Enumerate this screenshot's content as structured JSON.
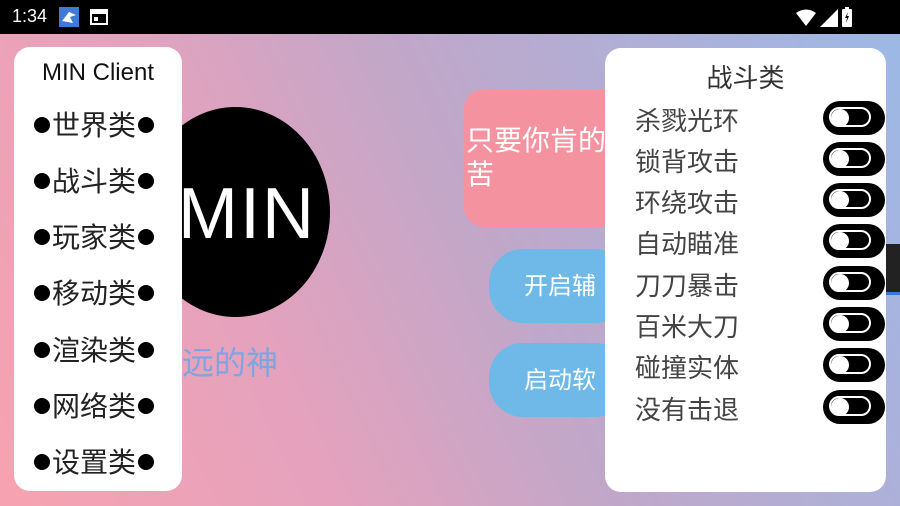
{
  "status_bar": {
    "time": "1:34",
    "icons": [
      "bird-app-icon",
      "window-app-icon",
      "wifi-icon",
      "signal-icon",
      "battery-icon"
    ]
  },
  "main": {
    "logo_text": "MIN",
    "subtitle": "远的神",
    "message": "只要你肯的苦",
    "button_1": "开启辅",
    "button_2": "启动软"
  },
  "sidebar": {
    "title": "MIN Client",
    "items": [
      {
        "label": "世界类"
      },
      {
        "label": "战斗类"
      },
      {
        "label": "玩家类"
      },
      {
        "label": "移动类"
      },
      {
        "label": "渲染类"
      },
      {
        "label": "网络类"
      },
      {
        "label": "设置类"
      }
    ]
  },
  "panel": {
    "title": "战斗类",
    "toggles": [
      {
        "label": "杀戮光环",
        "state": "off"
      },
      {
        "label": "锁背攻击",
        "state": "off"
      },
      {
        "label": "环绕攻击",
        "state": "off"
      },
      {
        "label": "自动瞄准",
        "state": "off"
      },
      {
        "label": "刀刀暴击",
        "state": "off"
      },
      {
        "label": "百米大刀",
        "state": "off"
      },
      {
        "label": "碰撞实体",
        "state": "off"
      },
      {
        "label": "没有击退",
        "state": "off"
      }
    ]
  },
  "colors": {
    "accent_pink": "#f5929f",
    "accent_blue": "#6eb9e7",
    "subtitle_blue": "#7da6e0"
  }
}
